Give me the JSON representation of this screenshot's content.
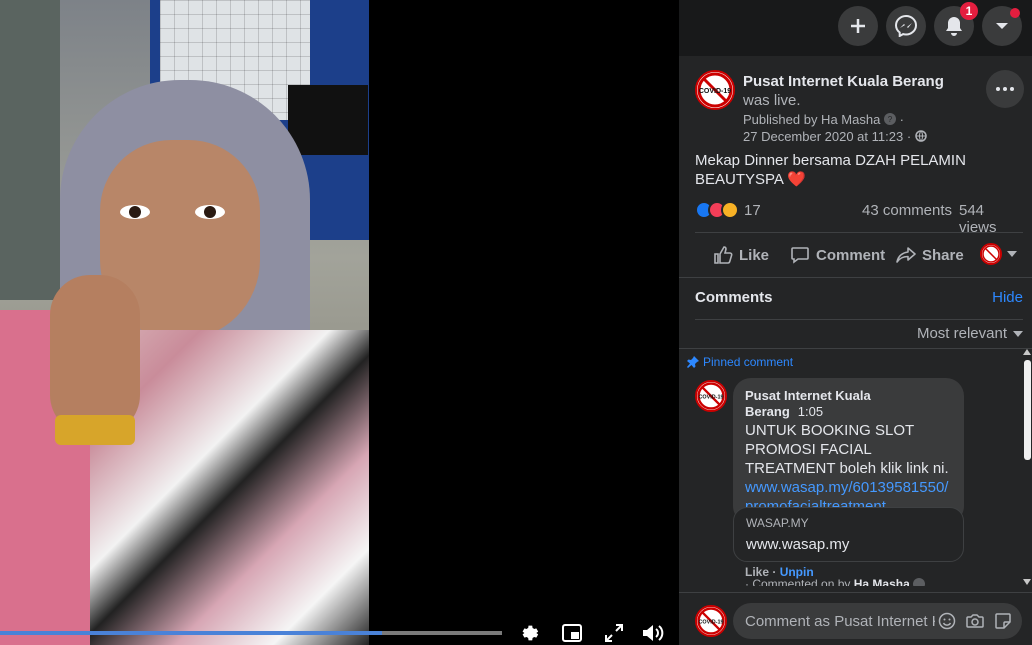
{
  "video": {
    "progress_fraction": 0.76,
    "controls": [
      "settings-icon",
      "picture-in-picture-icon",
      "fullscreen-icon",
      "volume-icon"
    ]
  },
  "topbar": {
    "notification_count": "1"
  },
  "post": {
    "author": "Pusat Internet Kuala Berang",
    "author_suffix": "was live.",
    "published_by": "Published by Ha Masha",
    "date": "27 December 2020 at 11:23 ·",
    "caption": "Mekap Dinner bersama DZAH PELAMIN BEAUTYSPA",
    "caption_emoji": "❤️",
    "reaction_count": "17",
    "comments_count": "43 comments",
    "views_count": "544 views",
    "avatar_text": "COVID-19"
  },
  "actions": {
    "like": "Like",
    "comment": "Comment",
    "share": "Share"
  },
  "comments_section": {
    "title": "Comments",
    "hide": "Hide",
    "sort": "Most relevant",
    "pinned_label": "Pinned comment"
  },
  "comment": {
    "author": "Pusat Internet Kuala Berang",
    "time": "1:05",
    "text": "UNTUK BOOKING SLOT PROMOSI FACIAL TREATMENT boleh klik link ni.",
    "link_line1": "www.wasap.my/60139581550/",
    "link_line2": "promofacialtreatment",
    "preview_domain": "WASAP.MY",
    "preview_title": "www.wasap.my",
    "like": "Like ·",
    "unpin": "Unpin",
    "commented_on_by": "· Commented on by",
    "commented_by_name": "Ha Masha"
  },
  "composer": {
    "placeholder": "Comment as Pusat Internet Kuala Berang"
  },
  "colors": {
    "panel_bg": "#242526",
    "accent_blue": "#2d88ff",
    "badge_red": "#e41e3f"
  }
}
